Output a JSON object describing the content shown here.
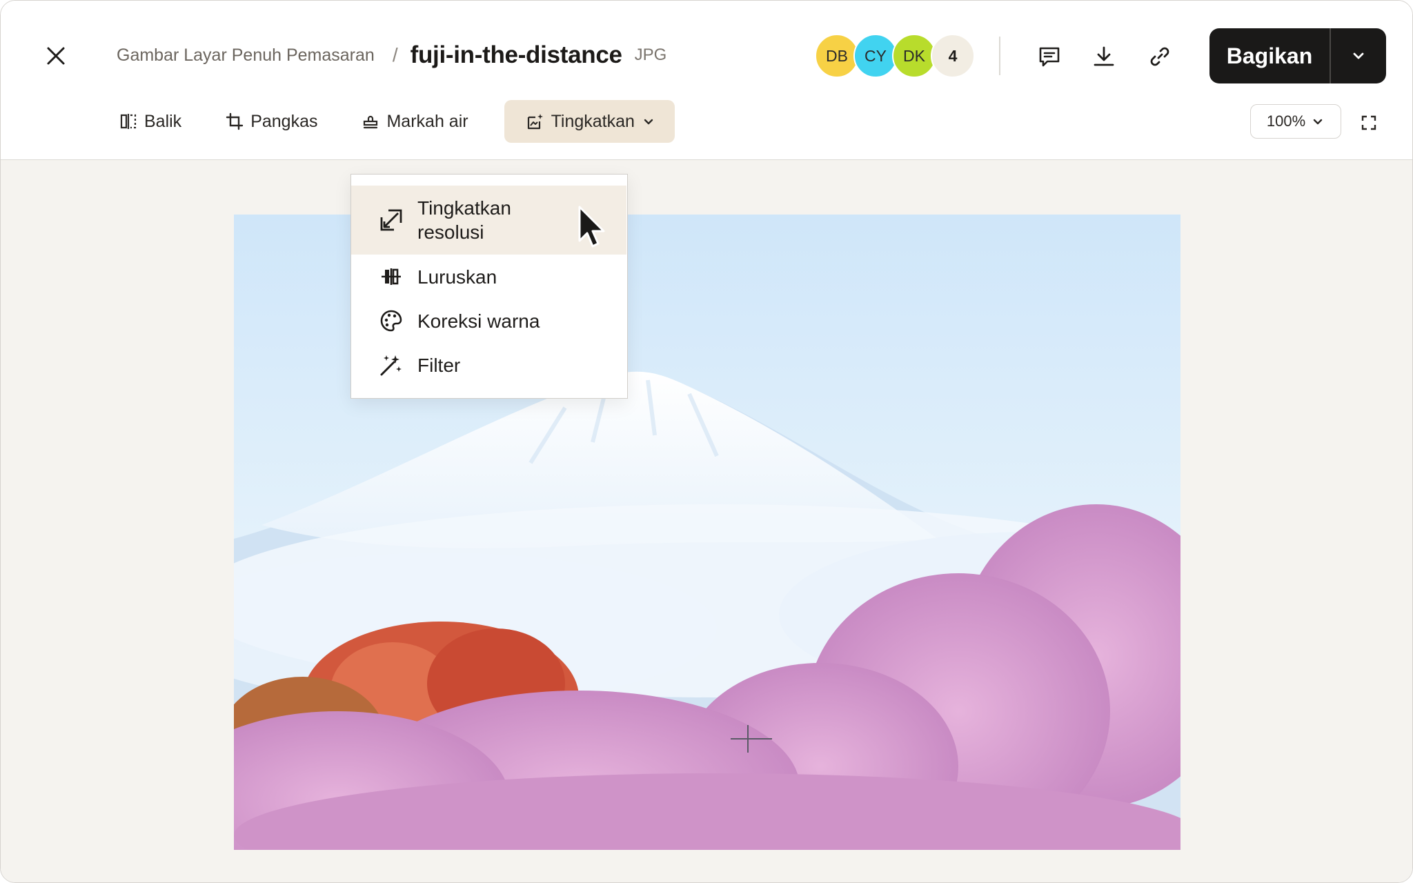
{
  "header": {
    "breadcrumb_parent": "Gambar Layar Penuh Pemasaran",
    "breadcrumb_separator": "/",
    "file_name": "fuji-in-the-distance",
    "file_ext": "JPG",
    "avatars": [
      {
        "initials": "DB",
        "color": "#f7d145"
      },
      {
        "initials": "CY",
        "color": "#41d3f0"
      },
      {
        "initials": "DK",
        "color": "#b8dc2c"
      },
      {
        "initials": "4",
        "color": "#f2ede3"
      }
    ],
    "share_label": "Bagikan"
  },
  "toolbar": {
    "flip": "Balik",
    "crop": "Pangkas",
    "watermark": "Markah air",
    "enhance": "Tingkatkan",
    "zoom": "100%"
  },
  "menu": {
    "items": [
      {
        "label": "Tingkatkan resolusi",
        "icon": "upscale-icon"
      },
      {
        "label": "Luruskan",
        "icon": "straighten-icon"
      },
      {
        "label": "Koreksi warna",
        "icon": "palette-icon"
      },
      {
        "label": "Filter",
        "icon": "magic-wand-icon"
      }
    ]
  },
  "colors": {
    "accent_active": "#efe5d6",
    "share_bg": "#1a1918",
    "canvas_bg": "#f5f3ef"
  }
}
